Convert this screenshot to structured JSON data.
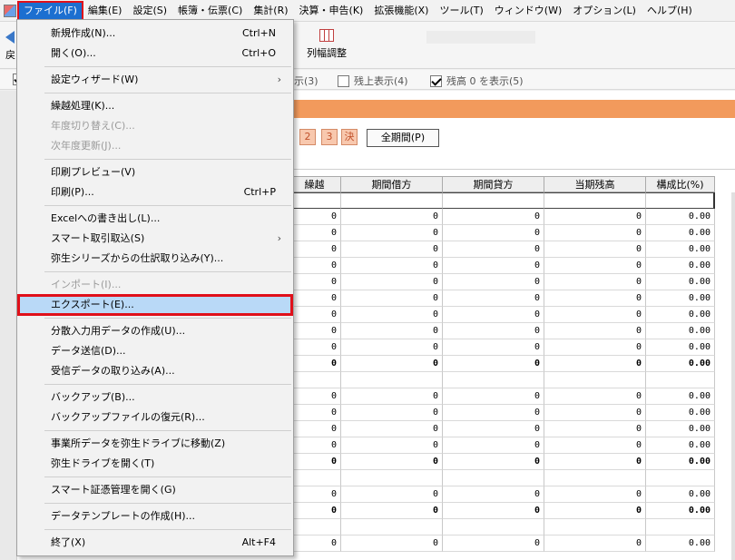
{
  "menubar": {
    "items": [
      {
        "label": "ファイル(F)",
        "active": true
      },
      {
        "label": "編集(E)"
      },
      {
        "label": "設定(S)"
      },
      {
        "label": "帳簿・伝票(C)"
      },
      {
        "label": "集計(R)"
      },
      {
        "label": "決算・申告(K)"
      },
      {
        "label": "拡張機能(X)"
      },
      {
        "label": "ツール(T)"
      },
      {
        "label": "ウィンドウ(W)"
      },
      {
        "label": "オプション(L)"
      },
      {
        "label": "ヘルプ(H)"
      }
    ]
  },
  "toolbar": {
    "back_label": "戻",
    "colwidth_label": "列幅調整"
  },
  "options": {
    "item3": "示(3)",
    "item4": "残上表示(4)",
    "item5": "残高 0 を表示(5)"
  },
  "period": {
    "buttons": [
      "2",
      "3",
      "決"
    ],
    "full_label": "全期間(P)"
  },
  "table": {
    "headers": [
      "繰越",
      "期間借方",
      "期間貸方",
      "当期残高",
      "構成比(%)"
    ],
    "rows": [
      {
        "cells": [
          "",
          "",
          "",
          "",
          ""
        ]
      },
      {
        "cells": [
          "0",
          "0",
          "0",
          "0",
          "0.00"
        ]
      },
      {
        "cells": [
          "0",
          "0",
          "0",
          "0",
          "0.00"
        ]
      },
      {
        "cells": [
          "0",
          "0",
          "0",
          "0",
          "0.00"
        ]
      },
      {
        "cells": [
          "0",
          "0",
          "0",
          "0",
          "0.00"
        ]
      },
      {
        "cells": [
          "0",
          "0",
          "0",
          "0",
          "0.00"
        ]
      },
      {
        "cells": [
          "0",
          "0",
          "0",
          "0",
          "0.00"
        ]
      },
      {
        "cells": [
          "0",
          "0",
          "0",
          "0",
          "0.00"
        ]
      },
      {
        "cells": [
          "0",
          "0",
          "0",
          "0",
          "0.00"
        ]
      },
      {
        "cells": [
          "0",
          "0",
          "0",
          "0",
          "0.00"
        ]
      },
      {
        "cells": [
          "0",
          "0",
          "0",
          "0",
          "0.00"
        ],
        "bold": true
      },
      {
        "cells": [
          "",
          "",
          "",
          "",
          ""
        ]
      },
      {
        "cells": [
          "0",
          "0",
          "0",
          "0",
          "0.00"
        ]
      },
      {
        "cells": [
          "0",
          "0",
          "0",
          "0",
          "0.00"
        ]
      },
      {
        "cells": [
          "0",
          "0",
          "0",
          "0",
          "0.00"
        ]
      },
      {
        "cells": [
          "0",
          "0",
          "0",
          "0",
          "0.00"
        ]
      },
      {
        "cells": [
          "0",
          "0",
          "0",
          "0",
          "0.00"
        ],
        "bold": true
      },
      {
        "cells": [
          "",
          "",
          "",
          "",
          ""
        ]
      },
      {
        "cells": [
          "0",
          "0",
          "0",
          "0",
          "0.00"
        ]
      },
      {
        "cells": [
          "0",
          "0",
          "0",
          "0",
          "0.00"
        ],
        "bold": true
      },
      {
        "cells": [
          "",
          "",
          "",
          "",
          ""
        ]
      },
      {
        "cells": [
          "0",
          "0",
          "0",
          "0",
          "0.00"
        ]
      }
    ]
  },
  "file_menu": {
    "items": [
      {
        "label": "新規作成(N)...",
        "shortcut": "Ctrl+N"
      },
      {
        "label": "開く(O)...",
        "shortcut": "Ctrl+O"
      },
      {
        "separator": true
      },
      {
        "label": "設定ウィザード(W)",
        "submenu": true
      },
      {
        "separator": true
      },
      {
        "label": "繰越処理(K)..."
      },
      {
        "label": "年度切り替え(C)...",
        "disabled": true
      },
      {
        "label": "次年度更新(J)...",
        "disabled": true
      },
      {
        "separator": true
      },
      {
        "label": "印刷プレビュー(V)"
      },
      {
        "label": "印刷(P)...",
        "shortcut": "Ctrl+P"
      },
      {
        "separator": true
      },
      {
        "label": "Excelへの書き出し(L)..."
      },
      {
        "label": "スマート取引取込(S)",
        "submenu": true
      },
      {
        "label": "弥生シリーズからの仕訳取り込み(Y)..."
      },
      {
        "separator": true
      },
      {
        "label": "インポート(I)...",
        "disabled": true
      },
      {
        "label": "エクスポート(E)...",
        "highlight": true
      },
      {
        "separator": true
      },
      {
        "label": "分散入力用データの作成(U)..."
      },
      {
        "label": "データ送信(D)..."
      },
      {
        "label": "受信データの取り込み(A)..."
      },
      {
        "separator": true
      },
      {
        "label": "バックアップ(B)..."
      },
      {
        "label": "バックアップファイルの復元(R)..."
      },
      {
        "separator": true
      },
      {
        "label": "事業所データを弥生ドライブに移動(Z)"
      },
      {
        "label": "弥生ドライブを開く(T)"
      },
      {
        "separator": true
      },
      {
        "label": "スマート証憑管理を開く(G)"
      },
      {
        "separator": true
      },
      {
        "label": "データテンプレートの作成(H)..."
      },
      {
        "separator": true
      },
      {
        "label": "終了(X)",
        "shortcut": "Alt+F4"
      }
    ]
  }
}
